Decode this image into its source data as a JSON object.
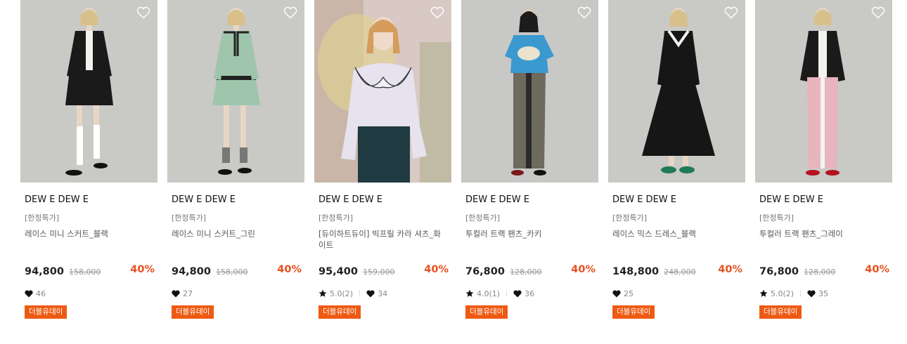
{
  "products": [
    {
      "brand": "DEW E DEW E",
      "tag": "[한정특가]",
      "name": "레이스 미니 스커트_블랙",
      "price": "94,800",
      "original_price": "158,000",
      "discount": "40%",
      "rating": null,
      "likes": "46",
      "badge": "더블유데이",
      "bg_color": "#c9c9c6",
      "outfit_color": "#1a1a1a"
    },
    {
      "brand": "DEW E DEW E",
      "tag": "[한정특가]",
      "name": "레이스 미니 스커트_그린",
      "price": "94,800",
      "original_price": "158,000",
      "discount": "40%",
      "rating": null,
      "likes": "27",
      "badge": "더블유데이",
      "bg_color": "#c9c9c6",
      "outfit_color": "#9fc6ac"
    },
    {
      "brand": "DEW E DEW E",
      "tag": "[한정특가]",
      "name": "[듀이하트듀이] 빅프릴 카라 셔츠_화이트",
      "price": "95,400",
      "original_price": "159,000",
      "discount": "40%",
      "rating": "5.0(2)",
      "likes": "34",
      "badge": "더블유데이",
      "bg_color": "#d9c9c4",
      "outfit_color": "#e6e2ee"
    },
    {
      "brand": "DEW E DEW E",
      "tag": "[한정특가]",
      "name": "투컬러 트랙 팬츠_카키",
      "price": "76,800",
      "original_price": "128,000",
      "discount": "40%",
      "rating": "4.0(1)",
      "likes": "36",
      "badge": "더블유데이",
      "bg_color": "#c8c8c6",
      "outfit_color": "#6f6a5e"
    },
    {
      "brand": "DEW E DEW E",
      "tag": "[한정특가]",
      "name": "레이스 믹스 드레스_블랙",
      "price": "148,800",
      "original_price": "248,000",
      "discount": "40%",
      "rating": null,
      "likes": "25",
      "badge": "더블유데이",
      "bg_color": "#c9c9c6",
      "outfit_color": "#161616"
    },
    {
      "brand": "DEW E DEW E",
      "tag": "[한정특가]",
      "name": "투컬러 트랙 팬츠_그레이",
      "price": "76,800",
      "original_price": "128,000",
      "discount": "40%",
      "rating": "5.0(2)",
      "likes": "35",
      "badge": "더블유데이",
      "bg_color": "#c9c9c6",
      "outfit_color": "#e8b4bd"
    }
  ],
  "icons": {
    "wishlist": "heart-outline-icon",
    "likes": "heart-filled-icon",
    "rating": "star-icon"
  },
  "colors": {
    "discount": "#e8501f",
    "badge_bg": "#ee5a12",
    "badge_text": "#ffffff"
  }
}
